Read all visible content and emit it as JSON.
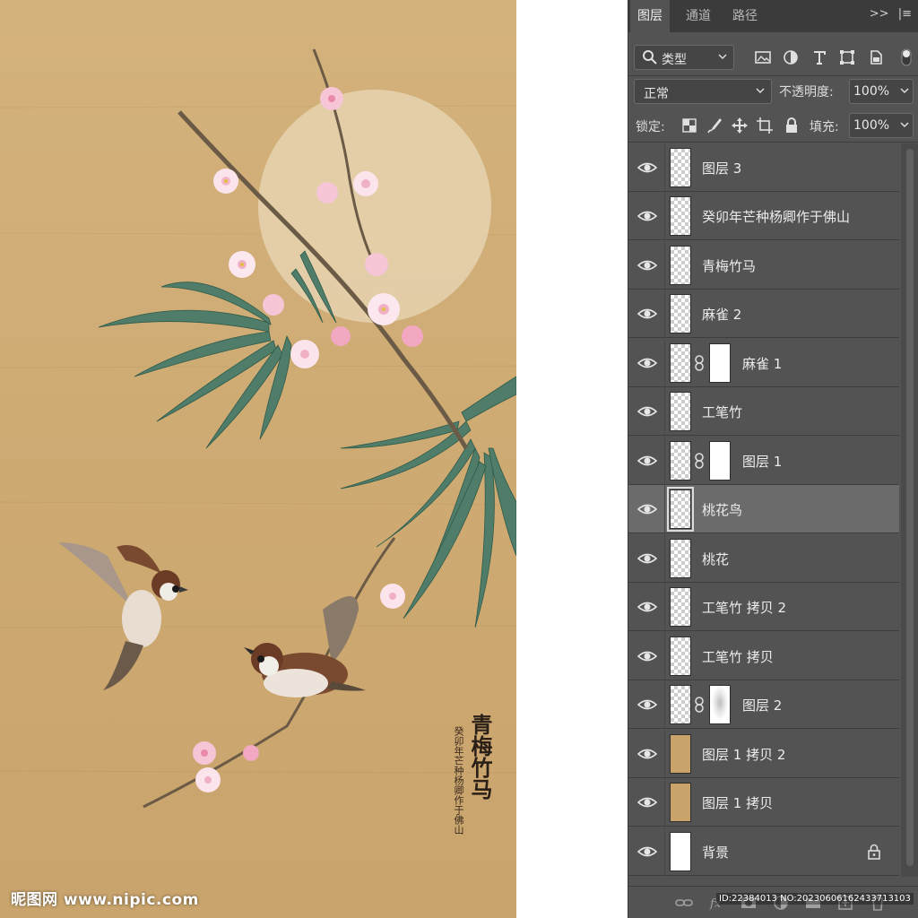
{
  "artwork": {
    "title_vertical": "青梅竹马",
    "inscription": "癸卯年芒种杨卿作于佛山",
    "watermark": "昵图网 www.nipic.com",
    "background_color": "#cfab74",
    "moon_color": "#e8d8b8"
  },
  "panel": {
    "tabs": [
      {
        "label": "图层",
        "active": true
      },
      {
        "label": "通道",
        "active": false
      },
      {
        "label": "路径",
        "active": false
      }
    ],
    "menu_icons": [
      "collapse-icon",
      "panel-menu-icon"
    ],
    "filter": {
      "label": "类型",
      "icons": [
        "image-filter-icon",
        "adjustment-filter-icon",
        "type-filter-icon",
        "shape-filter-icon",
        "smart-object-filter-icon",
        "filter-toggle-icon"
      ]
    },
    "blend_mode": "正常",
    "opacity_label": "不透明度:",
    "opacity_value": "100%",
    "lock_label": "锁定:",
    "lock_icons": [
      "lock-transparent-icon",
      "lock-image-icon",
      "lock-position-icon",
      "lock-artboard-icon",
      "lock-all-icon"
    ],
    "fill_label": "填充:",
    "fill_value": "100%",
    "id_text": "ID:22384013 NO:20230606162433713103"
  },
  "layers": [
    {
      "name": "图层 3",
      "thumb": "transparent",
      "mask": false,
      "selected": false,
      "locked": false
    },
    {
      "name": "癸卯年芒种杨卿作于佛山",
      "thumb": "transparent",
      "mask": false,
      "selected": false,
      "locked": false
    },
    {
      "name": "青梅竹马",
      "thumb": "transparent",
      "mask": false,
      "selected": false,
      "locked": false
    },
    {
      "name": "麻雀 2",
      "thumb": "transparent",
      "mask": false,
      "selected": false,
      "locked": false
    },
    {
      "name": "麻雀 1",
      "thumb": "transparent",
      "mask": true,
      "selected": false,
      "locked": false
    },
    {
      "name": "工笔竹",
      "thumb": "transparent",
      "mask": false,
      "selected": false,
      "locked": false
    },
    {
      "name": "图层 1",
      "thumb": "transparent",
      "mask": true,
      "selected": false,
      "locked": false
    },
    {
      "name": "桃花鸟",
      "thumb": "transparent",
      "mask": false,
      "selected": true,
      "locked": false
    },
    {
      "name": "桃花",
      "thumb": "transparent",
      "mask": false,
      "selected": false,
      "locked": false
    },
    {
      "name": "工笔竹 拷贝 2",
      "thumb": "transparent",
      "mask": false,
      "selected": false,
      "locked": false
    },
    {
      "name": "工笔竹 拷贝",
      "thumb": "transparent",
      "mask": false,
      "selected": false,
      "locked": false
    },
    {
      "name": "图层 2",
      "thumb": "transparent",
      "mask": true,
      "mask_style": "blur",
      "selected": false,
      "locked": false
    },
    {
      "name": "图层 1 拷贝 2",
      "thumb": "paper",
      "mask": false,
      "selected": false,
      "locked": false
    },
    {
      "name": "图层 1 拷贝",
      "thumb": "paper",
      "mask": false,
      "selected": false,
      "locked": false
    },
    {
      "name": "背景",
      "thumb": "white",
      "mask": false,
      "selected": false,
      "locked": true
    }
  ],
  "bottom_icons": [
    "link-layers-icon",
    "fx-icon",
    "add-mask-icon",
    "adjustment-layer-icon",
    "new-group-icon",
    "new-layer-icon",
    "delete-layer-icon"
  ]
}
